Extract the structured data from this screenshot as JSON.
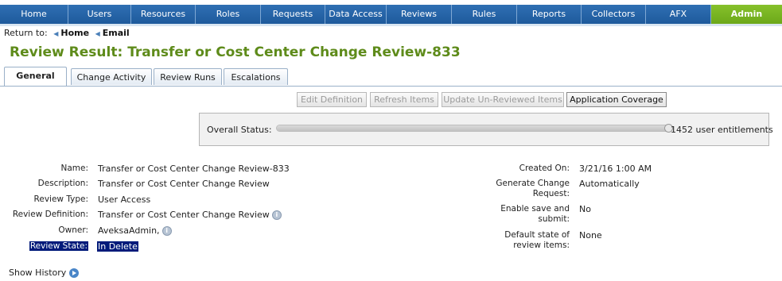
{
  "nav": [
    "Home",
    "Users",
    "Resources",
    "Roles",
    "Requests",
    "Data Access",
    "Reviews",
    "Rules",
    "Reports",
    "Collectors",
    "AFX",
    "Admin"
  ],
  "breadcrumb": {
    "prefix": "Return to:",
    "items": [
      "Home",
      "Email"
    ]
  },
  "page_title": "Review Result: Transfer or Cost Center Change Review-833",
  "tabs": [
    "General",
    "Change Activity",
    "Review Runs",
    "Escalations"
  ],
  "buttons": [
    "Edit Definition",
    "Refresh Items",
    "Update Un-Reviewed Items",
    "Application Coverage"
  ],
  "status": {
    "label": "Overall Status:",
    "value": "1452 user entitlements",
    "progress": 1.0
  },
  "details_left": [
    {
      "label": "Name:",
      "value": "Transfer or Cost Center Change Review-833"
    },
    {
      "label": "Description:",
      "value": "Transfer or Cost Center Change Review"
    },
    {
      "label": "Review Type:",
      "value": "User Access"
    },
    {
      "label": "Review Definition:",
      "value": "Transfer or Cost Center Change Review"
    },
    {
      "label": "Owner:",
      "value": "AveksaAdmin,"
    },
    {
      "label": "Review State:",
      "value": "In Delete"
    }
  ],
  "details_right": [
    {
      "label": "Created On:",
      "value": "3/21/16 1:00 AM"
    },
    {
      "label": "Generate Change Request:",
      "value": "Automatically"
    },
    {
      "label": "Enable save and submit:",
      "value": "No"
    },
    {
      "label": "Default state of review items:",
      "value": "None"
    }
  ],
  "show_history": "Show History",
  "icons": {
    "breadcrumb_sep": "left-arrow-icon",
    "info": "info-icon",
    "show_history": "play-icon"
  }
}
